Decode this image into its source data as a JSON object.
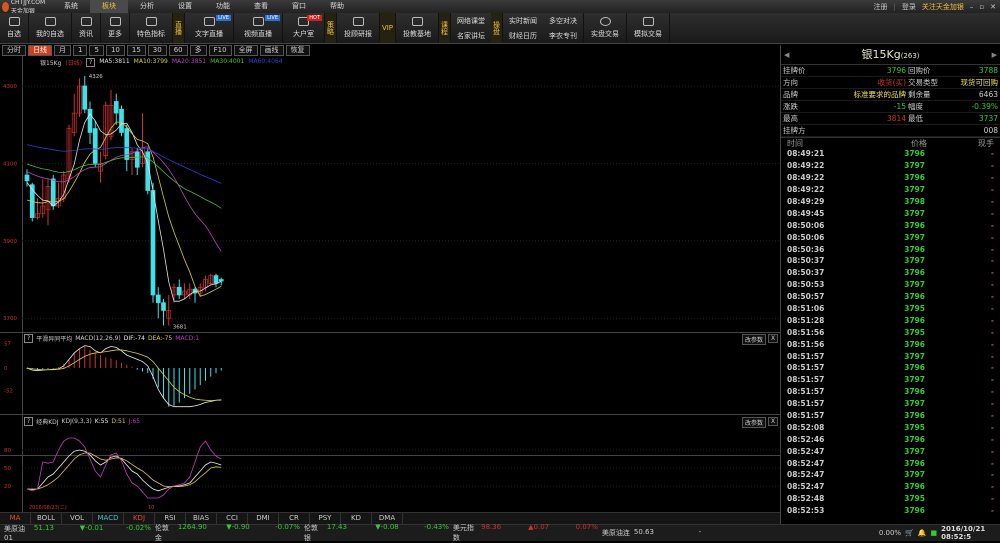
{
  "app": {
    "logo_text": "CHTJJY.COM 天金加银",
    "menu": [
      "系统",
      "板块",
      "分析",
      "设置",
      "功能",
      "查看",
      "窗口",
      "帮助"
    ],
    "active_menu": 1,
    "register": "注册",
    "login": "登录",
    "follow": "关注天金加银"
  },
  "toolbar": {
    "items": [
      {
        "label": "自选",
        "icon": "star-icon"
      },
      {
        "label": "我的自选",
        "icon": "home-icon"
      },
      {
        "label": "资讯",
        "icon": "news-icon"
      },
      {
        "label": "更多",
        "icon": "more-icon"
      },
      {
        "label": "特色指标",
        "icon": "indicator-icon"
      }
    ],
    "live_tag": "直播",
    "live_items": [
      {
        "label": "文字直播",
        "badge": "LIVE"
      },
      {
        "label": "视频直播",
        "badge": "LIVE"
      },
      {
        "label": "大户室",
        "badge": "HOT"
      }
    ],
    "strategy_tag": "策略",
    "research": "投顾研报",
    "vip_tag": "VIP",
    "edu": "投教基地",
    "course_tag": "课程",
    "course_links": [
      "网络课堂",
      "名家讲坛"
    ],
    "ops_tag": "操盘",
    "news_links": [
      "实时新闻",
      "财经日历"
    ],
    "duel_links": [
      "多空对决",
      "李农专刊"
    ],
    "trade_real": "实盘交易",
    "trade_sim": "模拟交易"
  },
  "chart_toolbar": [
    "分时",
    "日线",
    "月",
    "1",
    "5",
    "10",
    "15",
    "30",
    "60",
    "多",
    "F10",
    "全屏",
    "画线",
    "恢复"
  ],
  "legend": {
    "symbol": "银15Kg",
    "period": "(日线)",
    "q": "?",
    "ma5": "MA5:3811",
    "ma10": "MA10:3799",
    "ma20": "MA20:3851",
    "ma30": "MA30:4001",
    "ma60": "MA60:4064"
  },
  "colors": {
    "up": "#d03030",
    "down": "#40e0e8",
    "ma5": "#e0e0e0",
    "ma10": "#d8d040",
    "ma20": "#c040c0",
    "ma30": "#40c040",
    "ma60": "#3040d0"
  },
  "chart_data": [
    {
      "type": "candlestick",
      "yticks": [
        4300,
        4100,
        3900,
        3700
      ],
      "ylim": [
        3650,
        4340
      ],
      "high_label": "4326",
      "low_label": "3681",
      "ohlc": [
        [
          4070,
          4085,
          4040,
          4055
        ],
        [
          4045,
          4050,
          3950,
          3960
        ],
        [
          3960,
          4010,
          3955,
          3970
        ],
        [
          3970,
          4060,
          3960,
          3990
        ],
        [
          3980,
          4060,
          3940,
          4040
        ],
        [
          4060,
          4070,
          3980,
          3990
        ],
        [
          3990,
          4050,
          3985,
          4010
        ],
        [
          4010,
          4080,
          4000,
          4070
        ],
        [
          4060,
          4200,
          4050,
          4190
        ],
        [
          4180,
          4280,
          4170,
          4230
        ],
        [
          4230,
          4320,
          4220,
          4300
        ],
        [
          4300,
          4326,
          4230,
          4240
        ],
        [
          4240,
          4260,
          4150,
          4180
        ],
        [
          4190,
          4210,
          4090,
          4100
        ],
        [
          4080,
          4130,
          4050,
          4100
        ],
        [
          4120,
          4260,
          4110,
          4250
        ],
        [
          4170,
          4290,
          4160,
          4250
        ],
        [
          4260,
          4280,
          4200,
          4230
        ],
        [
          4240,
          4250,
          4170,
          4180
        ],
        [
          4190,
          4200,
          4080,
          4110
        ],
        [
          4110,
          4140,
          4070,
          4130
        ],
        [
          4130,
          4140,
          4070,
          4090
        ],
        [
          4100,
          4230,
          4090,
          4140
        ],
        [
          4130,
          4140,
          4020,
          4030
        ],
        [
          4030,
          4050,
          3740,
          3760
        ],
        [
          3760,
          3780,
          3700,
          3740
        ],
        [
          3740,
          3750,
          3681,
          3720
        ],
        [
          3700,
          3760,
          3681,
          3720
        ],
        [
          3760,
          3790,
          3740,
          3780
        ],
        [
          3780,
          3800,
          3750,
          3760
        ],
        [
          3760,
          3790,
          3750,
          3770
        ],
        [
          3760,
          3790,
          3750,
          3775
        ],
        [
          3775,
          3780,
          3740,
          3765
        ],
        [
          3765,
          3790,
          3755,
          3780
        ],
        [
          3780,
          3810,
          3770,
          3800
        ],
        [
          3790,
          3815,
          3785,
          3810
        ],
        [
          3810,
          3815,
          3780,
          3790
        ],
        [
          3800,
          3805,
          3785,
          3796
        ]
      ]
    },
    {
      "type": "macd",
      "title": "平滑异同平均",
      "params": "MACD(12,26,9)",
      "dif_label": "DIF:-74",
      "dea_label": "DEA:-75",
      "macd_label": "MACD:1",
      "yticks": [
        "57",
        "0",
        "-52"
      ],
      "ylim": [
        -110,
        70
      ],
      "hist": [
        -2,
        -3,
        -4,
        -3,
        -2,
        -1,
        2,
        10,
        20,
        35,
        45,
        50,
        42,
        35,
        30,
        25,
        22,
        18,
        12,
        8,
        3,
        -4,
        -8,
        -12,
        -25,
        -45,
        -70,
        -90,
        -88,
        -80,
        -70,
        -60,
        -50,
        -40,
        -30,
        -20,
        -12,
        -6
      ],
      "dif": [
        0,
        -5,
        -6,
        -5,
        -4,
        -3,
        -2,
        5,
        20,
        35,
        45,
        52,
        50,
        40,
        35,
        45,
        50,
        48,
        40,
        30,
        25,
        20,
        15,
        5,
        -20,
        -50,
        -70,
        -85,
        -90,
        -90,
        -90,
        -90,
        -88,
        -85,
        -80,
        -78,
        -75,
        -74
      ],
      "dea": [
        0,
        -2,
        -3,
        -4,
        -4,
        -4,
        -3,
        -1,
        5,
        12,
        20,
        27,
        32,
        35,
        36,
        38,
        40,
        42,
        42,
        40,
        37,
        34,
        30,
        25,
        15,
        0,
        -15,
        -30,
        -45,
        -55,
        -62,
        -68,
        -72,
        -74,
        -75,
        -76,
        -75,
        -75
      ]
    },
    {
      "type": "kdj",
      "title": "经典KDJ",
      "params": "KDJ(9,3,3)",
      "k_label": "K:55",
      "d_label": "D:51",
      "j_label": "J:65",
      "yticks": [
        "80",
        "50",
        "20"
      ],
      "ylim": [
        -5,
        115
      ],
      "k": [
        15,
        14,
        15,
        25,
        35,
        40,
        50,
        60,
        70,
        78,
        80,
        78,
        72,
        62,
        55,
        60,
        68,
        70,
        65,
        55,
        45,
        40,
        30,
        22,
        15,
        12,
        15,
        18,
        20,
        20,
        22,
        25,
        35,
        45,
        55,
        60,
        58,
        55
      ],
      "d": [
        15,
        15,
        15,
        18,
        22,
        28,
        35,
        45,
        55,
        65,
        72,
        75,
        75,
        70,
        65,
        63,
        65,
        67,
        66,
        62,
        56,
        50,
        45,
        38,
        30,
        25,
        20,
        19,
        19,
        19,
        20,
        22,
        27,
        35,
        42,
        50,
        52,
        51
      ],
      "j": [
        15,
        12,
        15,
        60,
        58,
        60,
        80,
        95,
        100,
        100,
        95,
        85,
        65,
        45,
        35,
        55,
        72,
        75,
        62,
        40,
        25,
        20,
        10,
        0,
        0,
        0,
        5,
        15,
        20,
        22,
        25,
        35,
        60,
        85,
        95,
        80,
        70,
        65
      ],
      "x_labels": [
        "2016/08/23(二)",
        "10"
      ]
    }
  ],
  "param_button": "改参数",
  "close_button": "X",
  "indicator_tabs": [
    "MA",
    "BOLL",
    "VOL",
    "MACD",
    "KDJ",
    "RSI",
    "BIAS",
    "CCI",
    "DMI",
    "CR",
    "PSY",
    "KD",
    "DMA"
  ],
  "right": {
    "title": "银15Kg",
    "code": "(263)",
    "info": [
      [
        "挂牌价",
        "3796",
        "回购价",
        "3788"
      ],
      [
        "方向",
        "收货(买)",
        "交易类型",
        "现货可回购"
      ],
      [
        "品牌",
        "标准要求的品牌",
        "剩余量",
        "6463"
      ],
      [
        "涨跌",
        "-15",
        "幅度",
        "-0.39%"
      ],
      [
        "最高",
        "3814",
        "最低",
        "3737"
      ],
      [
        "挂牌方",
        "",
        "",
        "008"
      ]
    ],
    "tick_headers": [
      "时间",
      "价格",
      "现手"
    ],
    "ticks": [
      [
        "08:49:21",
        "3796"
      ],
      [
        "08:49:22",
        "3797"
      ],
      [
        "08:49:22",
        "3796"
      ],
      [
        "08:49:22",
        "3797"
      ],
      [
        "08:49:29",
        "3798"
      ],
      [
        "08:49:45",
        "3797"
      ],
      [
        "08:50:06",
        "3796"
      ],
      [
        "08:50:06",
        "3797"
      ],
      [
        "08:50:36",
        "3796"
      ],
      [
        "08:50:37",
        "3797"
      ],
      [
        "08:50:37",
        "3796"
      ],
      [
        "08:50:53",
        "3797"
      ],
      [
        "08:50:57",
        "3796"
      ],
      [
        "08:51:06",
        "3795"
      ],
      [
        "08:51:28",
        "3796"
      ],
      [
        "08:51:56",
        "3795"
      ],
      [
        "08:51:56",
        "3796"
      ],
      [
        "08:51:57",
        "3797"
      ],
      [
        "08:51:57",
        "3796"
      ],
      [
        "08:51:57",
        "3797"
      ],
      [
        "08:51:57",
        "3796"
      ],
      [
        "08:51:57",
        "3797"
      ],
      [
        "08:51:57",
        "3796"
      ],
      [
        "08:52:08",
        "3795"
      ],
      [
        "08:52:46",
        "3796"
      ],
      [
        "08:52:47",
        "3797"
      ],
      [
        "08:52:47",
        "3796"
      ],
      [
        "08:52:47",
        "3797"
      ],
      [
        "08:52:47",
        "3796"
      ],
      [
        "08:52:48",
        "3795"
      ],
      [
        "08:52:53",
        "3796"
      ]
    ],
    "tick_vol": "-"
  },
  "status": {
    "items": [
      {
        "name": "美原油01",
        "price": "51.13",
        "chg": "▼-0.01",
        "pct": "-0.02%",
        "dir": "down"
      },
      {
        "name": "伦敦金",
        "price": "1264.90",
        "chg": "▼-0.90",
        "pct": "-0.07%",
        "dir": "down"
      },
      {
        "name": "伦敦银",
        "price": "17.43",
        "chg": "▼-0.08",
        "pct": "-0.43%",
        "dir": "down"
      },
      {
        "name": "美元指数",
        "price": "98.36",
        "chg": "▲0.07",
        "pct": "0.07%",
        "dir": "up"
      },
      {
        "name": "美原油连",
        "price": "50.63",
        "chg": "-",
        "pct": "0.00%",
        "dir": "flat"
      }
    ],
    "datetime": "2016/10/21 08:52:5"
  }
}
